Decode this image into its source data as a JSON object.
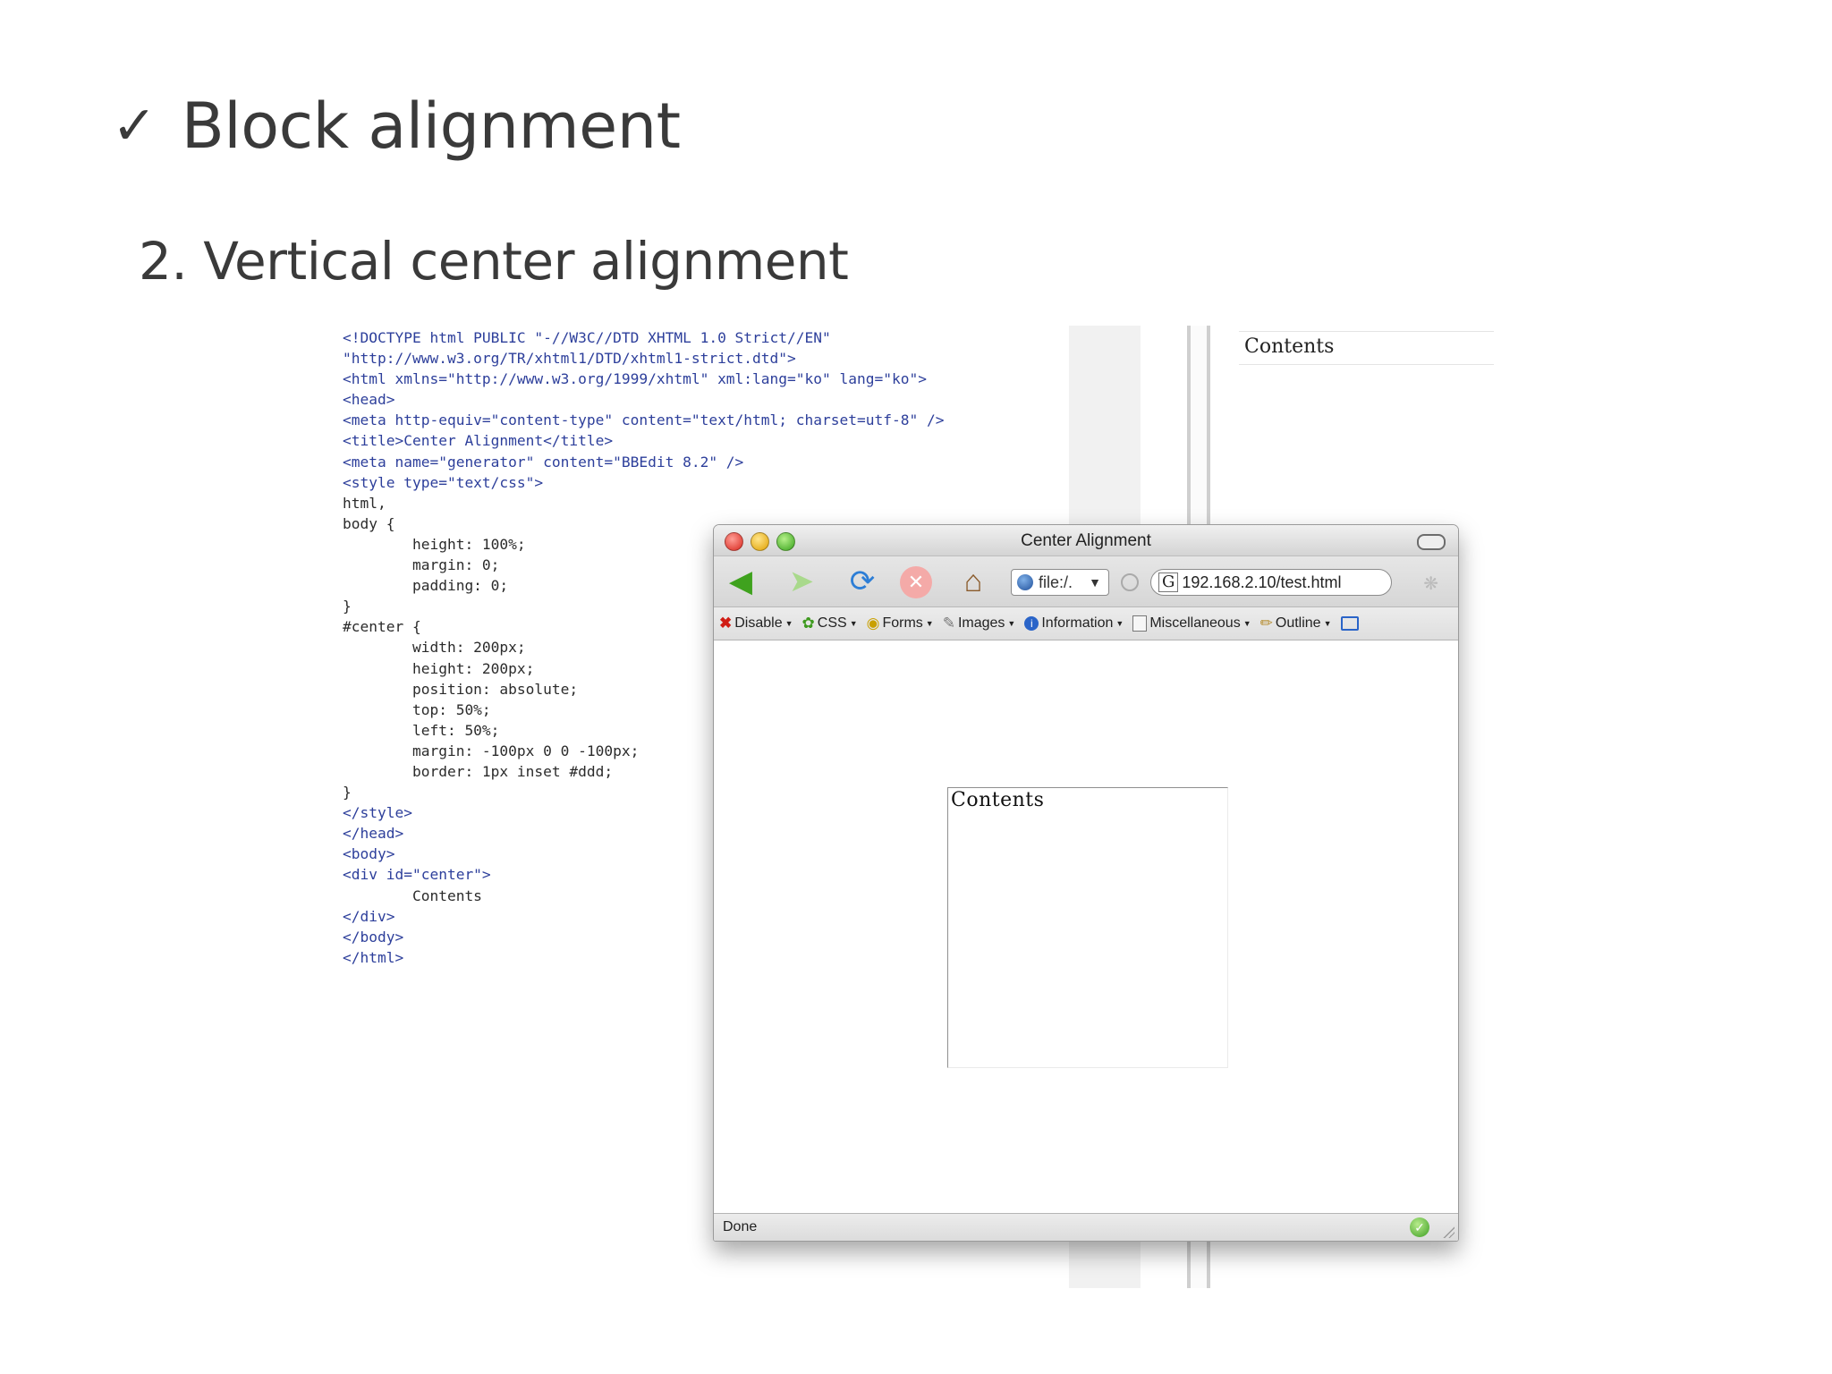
{
  "slide": {
    "check_mark": "✓",
    "title": "Block alignment",
    "subtitle": "2. Vertical center alignment"
  },
  "code": {
    "lines": [
      "<!DOCTYPE html PUBLIC \"-//W3C//DTD XHTML 1.0 Strict//EN\"",
      "\"http://www.w3.org/TR/xhtml1/DTD/xhtml1-strict.dtd\">",
      "<html xmlns=\"http://www.w3.org/1999/xhtml\" xml:lang=\"ko\" lang=\"ko\">",
      "<head>",
      "<meta http-equiv=\"content-type\" content=\"text/html; charset=utf-8\" />",
      "<title>Center Alignment</title>",
      "<meta name=\"generator\" content=\"BBEdit 8.2\" />",
      "<style type=\"text/css\">",
      "html,",
      "body {",
      "        height: 100%;",
      "        margin: 0;",
      "        padding: 0;",
      "}",
      "#center {",
      "        width: 200px;",
      "        height: 200px;",
      "        position: absolute;",
      "        top: 50%;",
      "        left: 50%;",
      "        margin: -100px 0 0 -100px;",
      "        border: 1px inset #ddd;",
      "}",
      "</style>",
      "</head>",
      "<body>",
      "<div id=\"center\">",
      "        Contents",
      "</div>",
      "</body>",
      "</html>"
    ]
  },
  "background_window": {
    "contents_text": "Contents"
  },
  "browser": {
    "title": "Center Alignment",
    "location_dropdown": "file:/.",
    "url": "192.168.2.10/test.html",
    "toolbar_items": [
      {
        "label": "Disable",
        "icon": "disable-icon"
      },
      {
        "label": "CSS",
        "icon": "css-icon"
      },
      {
        "label": "Forms",
        "icon": "forms-icon"
      },
      {
        "label": "Images",
        "icon": "images-icon"
      },
      {
        "label": "Information",
        "icon": "information-icon"
      },
      {
        "label": "Miscellaneous",
        "icon": "miscellaneous-icon"
      },
      {
        "label": "Outline",
        "icon": "outline-icon"
      }
    ],
    "page_content": "Contents",
    "status": "Done"
  }
}
